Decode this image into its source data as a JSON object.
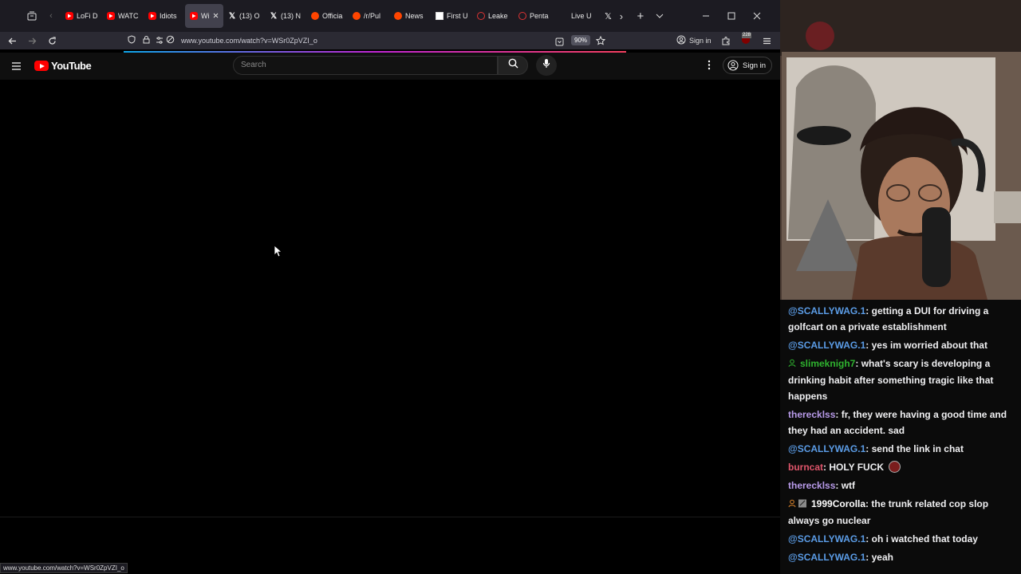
{
  "browser": {
    "tabs": [
      {
        "label": "LoFi D",
        "icon": "youtube-favicon",
        "kind": "yt",
        "active": false
      },
      {
        "label": "WATC",
        "icon": "youtube-favicon",
        "kind": "yt",
        "active": false
      },
      {
        "label": "Idiots",
        "icon": "youtube-favicon",
        "kind": "yt",
        "active": false
      },
      {
        "label": "Wi",
        "icon": "youtube-favicon",
        "kind": "yt",
        "active": true
      },
      {
        "label": "(13) O",
        "icon": "x-favicon",
        "kind": "x",
        "active": false
      },
      {
        "label": "(13) N",
        "icon": "x-favicon",
        "kind": "x",
        "active": false
      },
      {
        "label": "Officia",
        "icon": "reddit-favicon",
        "kind": "reddit",
        "active": false
      },
      {
        "label": "/r/Pul",
        "icon": "reddit-favicon",
        "kind": "reddit",
        "active": false
      },
      {
        "label": "News",
        "icon": "reddit-favicon",
        "kind": "reddit",
        "active": false
      },
      {
        "label": "First U",
        "icon": "news-favicon",
        "kind": "news",
        "active": false
      },
      {
        "label": "Leake",
        "icon": "site-favicon",
        "kind": "red-o",
        "active": false
      },
      {
        "label": "Penta",
        "icon": "site-favicon",
        "kind": "red-o",
        "active": false
      },
      {
        "label": "Live U",
        "icon": "site-favicon",
        "kind": "blank",
        "active": false
      }
    ],
    "url": "www.youtube.com/watch?v=WSr0ZpVZI_o",
    "zoom": "90%",
    "signin_label": "Sign in",
    "extension_badge": "228",
    "status_url": "www.youtube.com/watch?v=WSr0ZpVZI_o"
  },
  "youtube": {
    "logo_text": "YouTube",
    "search_placeholder": "Search",
    "signin_label": "Sign in"
  },
  "chat": {
    "messages": [
      {
        "user": "@SCALLYWAG.1",
        "text": ": getting a DUI for driving a golfcart on a private establishment",
        "color": "#5b9ce6",
        "badge": ""
      },
      {
        "user": "@SCALLYWAG.1",
        "text": ": yes im worried about that",
        "color": "#5b9ce6",
        "badge": ""
      },
      {
        "user": "slimeknigh7",
        "text": ": what's scary is developing a drinking habit after something tragic like that happens",
        "color": "#2fb32f",
        "badge": "user-icon"
      },
      {
        "user": "therecklss",
        "text": ": fr, they were having a good time and they had an accident. sad",
        "color": "#b79ae8",
        "badge": ""
      },
      {
        "user": "@SCALLYWAG.1",
        "text": ": send the link in chat",
        "color": "#5b9ce6",
        "badge": ""
      },
      {
        "user": "burncat",
        "text": ": HOLY FUCK",
        "color": "#e0556b",
        "badge": "",
        "emote": true
      },
      {
        "user": "therecklss",
        "text": ": wtf",
        "color": "#b79ae8",
        "badge": ""
      },
      {
        "user": "1999Corolla",
        "text": ": the trunk related cop slop always go nuclear",
        "color": "#ffffff",
        "badge": "dual"
      },
      {
        "user": "@SCALLYWAG.1",
        "text": ": oh i watched that today",
        "color": "#5b9ce6",
        "badge": ""
      },
      {
        "user": "@SCALLYWAG.1",
        "text": ": yeah",
        "color": "#5b9ce6",
        "badge": ""
      }
    ]
  }
}
